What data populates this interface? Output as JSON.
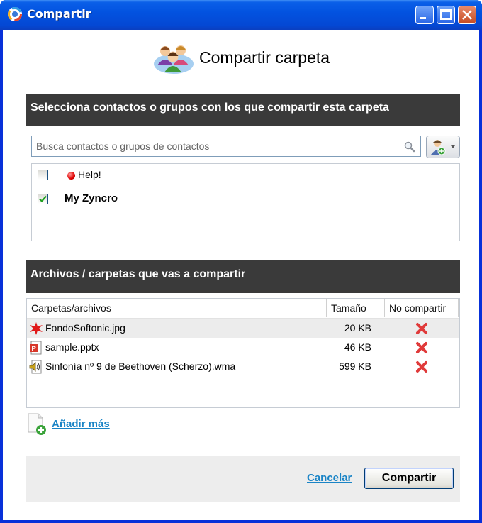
{
  "window": {
    "title": "Compartir"
  },
  "header": {
    "title": "Compartir carpeta"
  },
  "contacts_section": {
    "title": "Selecciona contactos o grupos con los que compartir esta carpeta",
    "search_placeholder": "Busca contactos o grupos de contactos",
    "items": [
      {
        "label": "Help!",
        "checked": false,
        "status_color": "#e00000"
      },
      {
        "label": "My Zyncro",
        "checked": true
      }
    ]
  },
  "files_section": {
    "title": "Archivos / carpetas que vas a compartir",
    "columns": [
      "Carpetas/archivos",
      "Tamaño",
      "No compartir"
    ],
    "rows": [
      {
        "name": "FondoSoftonic.jpg",
        "size": "20 KB",
        "icon": "image-file-icon"
      },
      {
        "name": "sample.pptx",
        "size": "46 KB",
        "icon": "presentation-file-icon"
      },
      {
        "name": "Sinfonía nº 9 de Beethoven (Scherzo).wma",
        "size": "599 KB",
        "icon": "audio-file-icon"
      }
    ]
  },
  "add_more_label": "Añadir más",
  "footer": {
    "cancel_label": "Cancelar",
    "share_label": "Compartir"
  },
  "colors": {
    "titlebar": "#0353e0",
    "section_bar": "#3a3a3a",
    "link": "#1a84c6",
    "remove": "#e03a3a"
  }
}
